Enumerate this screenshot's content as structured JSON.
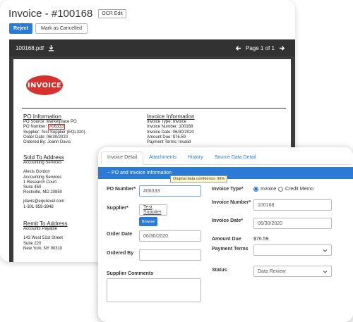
{
  "header": {
    "title": "Invoice  - #100168",
    "ocr_edit_label": "OCR Edit"
  },
  "toolbar": {
    "reject_label": "Reject",
    "mark_cancelled_label": "Mark as Cancelled"
  },
  "pdf": {
    "filename": "100168.pdf",
    "page_indicator": "Page 1 of 1",
    "icons": {
      "download": "download-icon",
      "prev": "arrow-left-icon",
      "next": "arrow-right-icon"
    },
    "logo_text": "INVOICE",
    "po_info": {
      "heading": "PO Information",
      "source": "PO Source: Marketplace PO",
      "po_number_label": "PO Number: ",
      "po_number": "#06333",
      "supplier": "Supplier: Test Supplier (EQL320)",
      "order_date": "Order Date: 06/30/2020",
      "ordered_by": "Ordered By: Joann Davis"
    },
    "invoice_info": {
      "heading": "Invoice Information",
      "type": "Invoice Type: Invoice",
      "number": "Invoice Number: 100168",
      "date": "Invoice Date: 06/30/2020",
      "amount_due": "Amount Due: $76.59",
      "terms": "Payment Terms: Invalid"
    },
    "sold_to": {
      "heading": "Sold To Address",
      "lines": [
        "Accounting Services",
        "",
        "Alexis Gordon",
        "Accounting Services",
        "1 Research Court",
        "Suite 450",
        "Rockville, MD 20850",
        "",
        "jdavis@equilevel.com",
        "1-301-959-3848"
      ]
    },
    "remit_to": {
      "heading": "Remit To Address",
      "lines": [
        "Accounts Payable",
        "",
        "143 West 51st Street",
        "Suite 220",
        "New York, NY 90310"
      ]
    }
  },
  "detail": {
    "tabs": [
      "Invoice Detail",
      "Attachments",
      "History",
      "Source Data Detail"
    ],
    "section_title": "− PO and Invoice Information",
    "tooltip": "Original data confidence: 99%",
    "po_number": {
      "label": "PO Number*",
      "value": "#06333"
    },
    "supplier": {
      "label": "Supplier*",
      "value": "Test Supplier",
      "browse_label": "Browse"
    },
    "order_date": {
      "label": "Order Date",
      "value": "06/30/2020"
    },
    "ordered_by": {
      "label": "Ordered By",
      "value": ""
    },
    "supplier_comments": {
      "label": "Supplier Comments",
      "value": ""
    },
    "invoice_type": {
      "label": "Invoice Type*",
      "options": [
        "Invoice",
        "Credit Memo"
      ],
      "selected": "Invoice"
    },
    "invoice_number": {
      "label": "Invoice Number*",
      "value": "100168"
    },
    "invoice_date": {
      "label": "Invoice Date*",
      "value": "06/30/2020"
    },
    "amount_due": {
      "label": "Amount Due",
      "value": "$76.59"
    },
    "payment_terms": {
      "label": "Payment Terms",
      "value": ""
    },
    "status": {
      "label": "Status",
      "value": "Data Review"
    }
  },
  "colors": {
    "accent": "#2b7bd6",
    "logo": "#d6312f",
    "pdf_background": "#3a3a3a"
  }
}
